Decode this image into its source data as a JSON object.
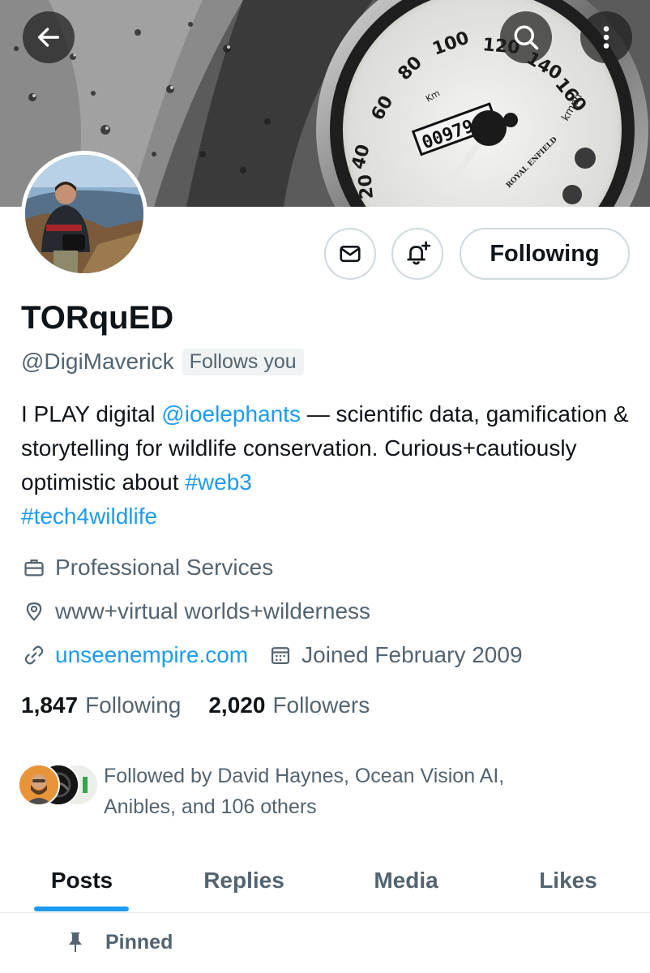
{
  "header": {
    "back_icon": "arrow-left-icon",
    "search_icon": "search-icon",
    "more_icon": "more-vertical-icon"
  },
  "banner": {
    "speed_labels": [
      "40",
      "60",
      "80",
      "100",
      "120",
      "140",
      "160",
      "20"
    ],
    "odometer": "009794",
    "unit_km": "Km",
    "unit_kmph": "kmph",
    "brand": "ROYAL ENFIELD"
  },
  "profile": {
    "display_name": "TORquED",
    "handle": "@DigiMaverick",
    "follows_you": "Follows you",
    "bio": {
      "part1": "I PLAY digital ",
      "mention": "@ioelephants",
      "part2": " — scientific data, gamification & storytelling for wildlife conservation. Curious+cautiously optimistic about ",
      "tag1": "#web3",
      "tag2": "#tech4wildlife"
    },
    "category": "Professional Services",
    "location": "www+virtual worlds+wilderness",
    "website": "unseenempire.com",
    "joined": "Joined February 2009"
  },
  "actions": {
    "following_label": "Following",
    "message_icon": "mail-icon",
    "notify_icon": "bell-plus-icon"
  },
  "stats": {
    "following_count": "1,847",
    "following_label": "Following",
    "followers_count": "2,020",
    "followers_label": "Followers"
  },
  "followed_by": {
    "line1": "Followed by David Haynes, Ocean Vision AI,",
    "line2": "Anibles, and 106 others"
  },
  "tabs": [
    {
      "label": "Posts",
      "active": true
    },
    {
      "label": "Replies",
      "active": false
    },
    {
      "label": "Media",
      "active": false
    },
    {
      "label": "Likes",
      "active": false
    }
  ],
  "pinned": {
    "label": "Pinned"
  },
  "colors": {
    "accent": "#1d9bf0",
    "text": "#0f1419",
    "muted": "#536471",
    "border": "#cfd9de"
  }
}
